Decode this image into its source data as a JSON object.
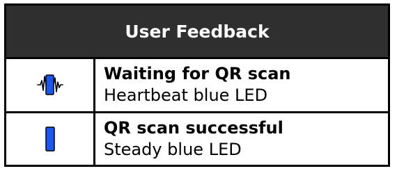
{
  "table": {
    "header": "User Feedback",
    "rows": [
      {
        "icon": "heartbeat-led-icon",
        "title": "Waiting for QR scan",
        "description": "Heartbeat blue LED"
      },
      {
        "icon": "steady-led-icon",
        "title": "QR scan successful",
        "description": "Steady blue LED"
      }
    ]
  },
  "colors": {
    "header_bg": "#2f2f2f",
    "led_blue": "#1a56f0",
    "border": "#000000"
  }
}
